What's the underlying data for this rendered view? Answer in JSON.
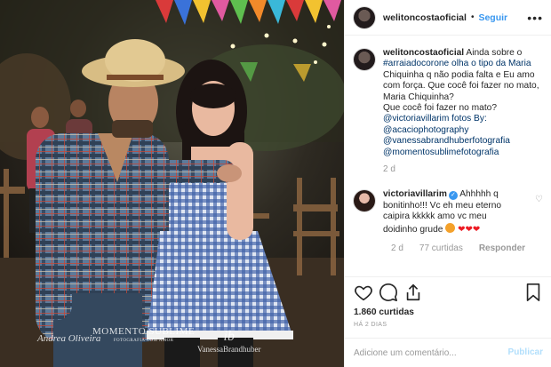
{
  "post": {
    "photo_watermarks": {
      "left": "Andrea Oliveira",
      "middle": "MOMENTO SUBLIME",
      "middle_sub": "FOTOGRAFIA COM AMOR",
      "right": "ib",
      "right_sub": "VanessaBrandhuber"
    }
  },
  "header": {
    "username": "welitoncostaoficial",
    "separator": "•",
    "follow_label": "Seguir",
    "more_icon": "more-horizontal-icon"
  },
  "caption": {
    "username": "welitoncostaoficial",
    "lines": [
      "Ainda sobre o",
      "#arraiadocorone olha o tipo da Maria",
      "Chiquinha q não podia falta e Eu amo",
      "com força. Que cocê foi fazer no mato,",
      "Maria Chiquinha?",
      "Que cocê foi fazer no mato?",
      "@victoriavillarim fotos By:",
      "@acaciophotography",
      "@vanessabrandhuberfotografia",
      "@momentosublimefotografia"
    ],
    "age": "2 d"
  },
  "comment": {
    "username": "victoriavillarim",
    "text_lines": [
      "Ahhhhh q",
      "bonitinho!!! Vc eh meu eterno",
      "caipira kkkkk amo vc meu",
      "doidinho grude"
    ],
    "age": "2 d",
    "likes": "77 curtidas",
    "reply_label": "Responder"
  },
  "actions": {
    "like_icon": "heart-icon",
    "comment_icon": "comment-icon",
    "share_icon": "share-icon",
    "save_icon": "bookmark-icon"
  },
  "likes_count": "1.860 curtidas",
  "posted_ago": "HÁ 2 DIAS",
  "add_comment": {
    "placeholder": "Adicione um comentário...",
    "publish_label": "Publicar"
  },
  "colors": {
    "accent": "#3897f0",
    "mention": "#003569",
    "muted": "#999999",
    "publish_disabled": "#b2dffc"
  }
}
